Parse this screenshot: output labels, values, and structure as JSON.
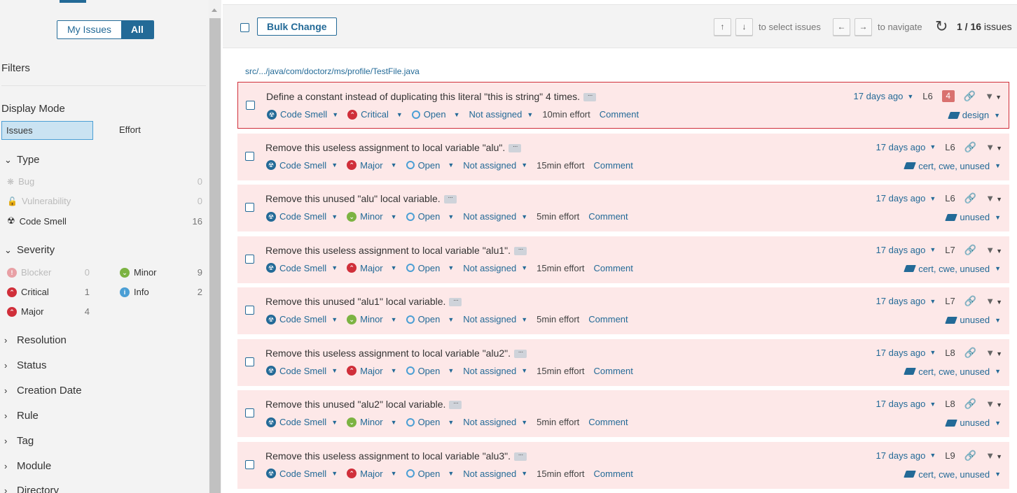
{
  "sidebar": {
    "toggle": {
      "my_issues": "My Issues",
      "all": "All"
    },
    "filters_title": "Filters",
    "display_mode": {
      "title": "Display Mode",
      "issues": "Issues",
      "effort": "Effort"
    },
    "type": {
      "title": "Type",
      "items": [
        {
          "label": "Bug",
          "count": "0",
          "icon": "bug-icon",
          "disabled": true
        },
        {
          "label": "Vulnerability",
          "count": "0",
          "icon": "lock-icon",
          "disabled": true
        },
        {
          "label": "Code Smell",
          "count": "16",
          "icon": "code-smell-icon",
          "disabled": false
        }
      ]
    },
    "severity": {
      "title": "Severity",
      "items": [
        {
          "label": "Blocker",
          "count": "0",
          "icon": "blocker-icon",
          "disabled": true
        },
        {
          "label": "Minor",
          "count": "9",
          "icon": "minor-icon",
          "disabled": false
        },
        {
          "label": "Critical",
          "count": "1",
          "icon": "critical-icon",
          "disabled": false
        },
        {
          "label": "Info",
          "count": "2",
          "icon": "info-icon",
          "disabled": false
        },
        {
          "label": "Major",
          "count": "4",
          "icon": "major-icon",
          "disabled": false
        }
      ]
    },
    "collapsed_facets": [
      "Resolution",
      "Status",
      "Creation Date",
      "Rule",
      "Tag",
      "Module",
      "Directory"
    ]
  },
  "topbar": {
    "bulk_change": "Bulk Change",
    "select_keys": [
      "↑",
      "↓"
    ],
    "select_note": "to select issues",
    "nav_keys": [
      "←",
      "→"
    ],
    "nav_note": "to navigate",
    "count_current": "1 / 16",
    "count_label": "issues"
  },
  "file_path": "src/.../java/com/doctorz/ms/profile/TestFile.java",
  "issues": [
    {
      "message": "Define a constant instead of duplicating this literal \"this is string\" 4 times.",
      "type": "Code Smell",
      "severity": "Critical",
      "status": "Open",
      "assignee": "Not assigned",
      "effort": "10min effort",
      "comment": "Comment",
      "age": "17 days ago",
      "line": "L6",
      "locations": "4",
      "tags": "design",
      "selected": true
    },
    {
      "message": "Remove this useless assignment to local variable \"alu\".",
      "type": "Code Smell",
      "severity": "Major",
      "status": "Open",
      "assignee": "Not assigned",
      "effort": "15min effort",
      "comment": "Comment",
      "age": "17 days ago",
      "line": "L6",
      "locations": "",
      "tags": "cert, cwe, unused",
      "selected": false
    },
    {
      "message": "Remove this unused \"alu\" local variable.",
      "type": "Code Smell",
      "severity": "Minor",
      "status": "Open",
      "assignee": "Not assigned",
      "effort": "5min effort",
      "comment": "Comment",
      "age": "17 days ago",
      "line": "L6",
      "locations": "",
      "tags": "unused",
      "selected": false
    },
    {
      "message": "Remove this useless assignment to local variable \"alu1\".",
      "type": "Code Smell",
      "severity": "Major",
      "status": "Open",
      "assignee": "Not assigned",
      "effort": "15min effort",
      "comment": "Comment",
      "age": "17 days ago",
      "line": "L7",
      "locations": "",
      "tags": "cert, cwe, unused",
      "selected": false
    },
    {
      "message": "Remove this unused \"alu1\" local variable.",
      "type": "Code Smell",
      "severity": "Minor",
      "status": "Open",
      "assignee": "Not assigned",
      "effort": "5min effort",
      "comment": "Comment",
      "age": "17 days ago",
      "line": "L7",
      "locations": "",
      "tags": "unused",
      "selected": false
    },
    {
      "message": "Remove this useless assignment to local variable \"alu2\".",
      "type": "Code Smell",
      "severity": "Major",
      "status": "Open",
      "assignee": "Not assigned",
      "effort": "15min effort",
      "comment": "Comment",
      "age": "17 days ago",
      "line": "L8",
      "locations": "",
      "tags": "cert, cwe, unused",
      "selected": false
    },
    {
      "message": "Remove this unused \"alu2\" local variable.",
      "type": "Code Smell",
      "severity": "Minor",
      "status": "Open",
      "assignee": "Not assigned",
      "effort": "5min effort",
      "comment": "Comment",
      "age": "17 days ago",
      "line": "L8",
      "locations": "",
      "tags": "unused",
      "selected": false
    },
    {
      "message": "Remove this useless assignment to local variable \"alu3\".",
      "type": "Code Smell",
      "severity": "Major",
      "status": "Open",
      "assignee": "Not assigned",
      "effort": "15min effort",
      "comment": "Comment",
      "age": "17 days ago",
      "line": "L9",
      "locations": "",
      "tags": "cert, cwe, unused",
      "selected": false
    }
  ]
}
